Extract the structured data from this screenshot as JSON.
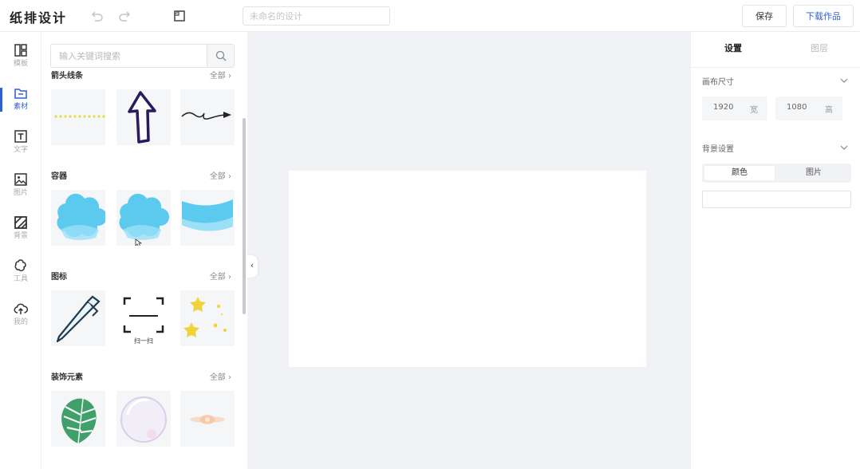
{
  "app": {
    "logo": "纸排设计"
  },
  "toolbar": {
    "undo_icon": "undo-icon",
    "redo_icon": "redo-icon",
    "size_icon": "ruler-icon",
    "title_placeholder": "未命名的设计",
    "save_label": "保存",
    "download_label": "下载作品"
  },
  "nav": {
    "items": [
      {
        "label": "模板",
        "icon": "template-icon"
      },
      {
        "label": "素材",
        "icon": "material-icon",
        "active": true
      },
      {
        "label": "文字",
        "icon": "text-icon"
      },
      {
        "label": "图片",
        "icon": "image-icon"
      },
      {
        "label": "背景",
        "icon": "background-icon"
      },
      {
        "label": "工具",
        "icon": "tool-icon"
      },
      {
        "label": "我的",
        "icon": "cloud-upload-icon"
      }
    ]
  },
  "material": {
    "search_placeholder": "输入关键词搜索",
    "sections": [
      {
        "title": "箭头线条",
        "all": "全部"
      },
      {
        "title": "容器",
        "all": "全部"
      },
      {
        "title": "图标",
        "all": "全部"
      },
      {
        "title": "装饰元素",
        "all": "全部"
      }
    ],
    "scan_caption": "扫一扫"
  },
  "settings": {
    "tab_settings": "设置",
    "tab_layers": "图层",
    "canvas_size_label": "画布尺寸",
    "width_value": "1920",
    "width_unit": "宽",
    "height_value": "1080",
    "height_unit": "高",
    "bg_label": "背景设置",
    "bg_color": "颜色",
    "bg_image": "图片"
  },
  "colors": {
    "accent": "#2f5fd6",
    "workspace": "#f1f2f5",
    "cyan": "#5cc9ef"
  }
}
